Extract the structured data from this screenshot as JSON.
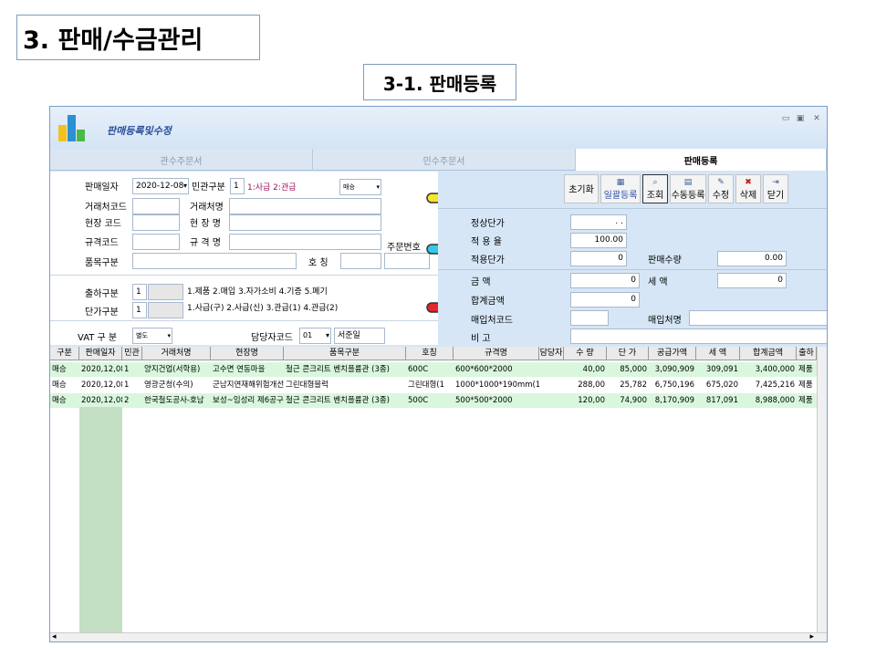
{
  "slide": {
    "section_title": "3. 판매/수금관리",
    "sub_title": "3-1. 판매등록"
  },
  "window": {
    "title": "판매등록및수정",
    "controls": [
      "▭",
      "▣",
      "✕"
    ]
  },
  "tabs": [
    {
      "label": "관수주문서",
      "active": false
    },
    {
      "label": "민수주문서",
      "active": false
    },
    {
      "label": "판매등록",
      "active": true
    }
  ],
  "form": {
    "sale_date_label": "판매일자",
    "sale_date": "2020-12-08",
    "govt_type_label": "민관구분",
    "govt_type_value": "1",
    "govt_type_hint": "1:사급 2:관급",
    "sale_kind": "매승",
    "client_code_label": "거래처코드",
    "client_name_label": "거래처명",
    "site_code_label": "현장 코드",
    "site_name_label": "현 장 명",
    "spec_code_label": "규격코드",
    "spec_name_label": "규 격 명",
    "order_no_label": "주문번호",
    "item_type_label": "품목구분",
    "size_label": "호 칭",
    "ship_type_label": "출하구분",
    "ship_type_value": "1",
    "ship_type_hint": "1.제품 2.매입 3.자가소비 4.기증 5.폐기",
    "price_type_label": "단가구분",
    "price_type_value": "1",
    "price_type_hint": "1.사급(구) 2.사급(신) 3.관급(1) 4.관급(2)",
    "vat_label": "VAT 구 분",
    "vat_value": "별도",
    "manager_code_label": "담당자코드",
    "manager_code": "01",
    "manager_name": "서준일"
  },
  "toolbar": [
    {
      "label": "초기화",
      "icon": ""
    },
    {
      "label": "일괄등록",
      "icon": "batch-icon"
    },
    {
      "label": "조회",
      "icon": "search-icon"
    },
    {
      "label": "수동등록",
      "icon": "manual-icon"
    },
    {
      "label": "수정",
      "icon": "edit-icon"
    },
    {
      "label": "삭제",
      "icon": "delete-icon"
    },
    {
      "label": "닫기",
      "icon": "exit-icon"
    }
  ],
  "pricing": {
    "normal_price_label": "정상단가",
    "normal_price_value": ". .",
    "rate_label": "적 용 율",
    "rate_value": "100.00",
    "applied_price_label": "적용단가",
    "applied_price_value": "0",
    "qty_label": "판매수량",
    "qty_value": "0.00",
    "amount_label": "금 액",
    "amount_value": "0",
    "tax_label": "세 액",
    "tax_value": "0",
    "total_label": "합계금액",
    "total_value": "0",
    "purchase_code_label": "매입처코드",
    "purchase_name_label": "매입처명",
    "remark_label": "비 고"
  },
  "grid": {
    "columns": [
      "구분",
      "판매일자",
      "민관",
      "거래처명",
      "현장명",
      "품목구분",
      "호칭",
      "규격명",
      "담당자",
      "수 량",
      "단 가",
      "공급가액",
      "세 액",
      "합계금액",
      "출하"
    ],
    "rows": [
      [
        "매승",
        "2020,12,08",
        "1",
        "양지건업(서학용)",
        "고수면 연동마을",
        "철근 콘크리트 벤치플륨관 (3종)",
        "600C",
        "600*600*2000",
        "",
        "40,00",
        "85,000",
        "3,090,909",
        "309,091",
        "3,400,000",
        "제품"
      ],
      [
        "매승",
        "2020,12,08",
        "1",
        "영광군청(수의)",
        "군남지연재해위험개선",
        "그린대형블럭",
        "그린대형(1",
        "1000*1000*190mm(1EA/",
        "",
        "288,00",
        "25,782",
        "6,750,196",
        "675,020",
        "7,425,216",
        "제품"
      ],
      [
        "매승",
        "2020,12,08",
        "2",
        "한국철도공사-호남",
        "보성~임성리 제6공구",
        "철근 콘크리트 벤치플륨관 (3종)",
        "500C",
        "500*500*2000",
        "",
        "120,00",
        "74,900",
        "8,170,909",
        "817,091",
        "8,988,000",
        "제품"
      ]
    ],
    "row_colors": [
      "#d9f7dd",
      "#ffffff",
      "#d9f7dd"
    ]
  }
}
